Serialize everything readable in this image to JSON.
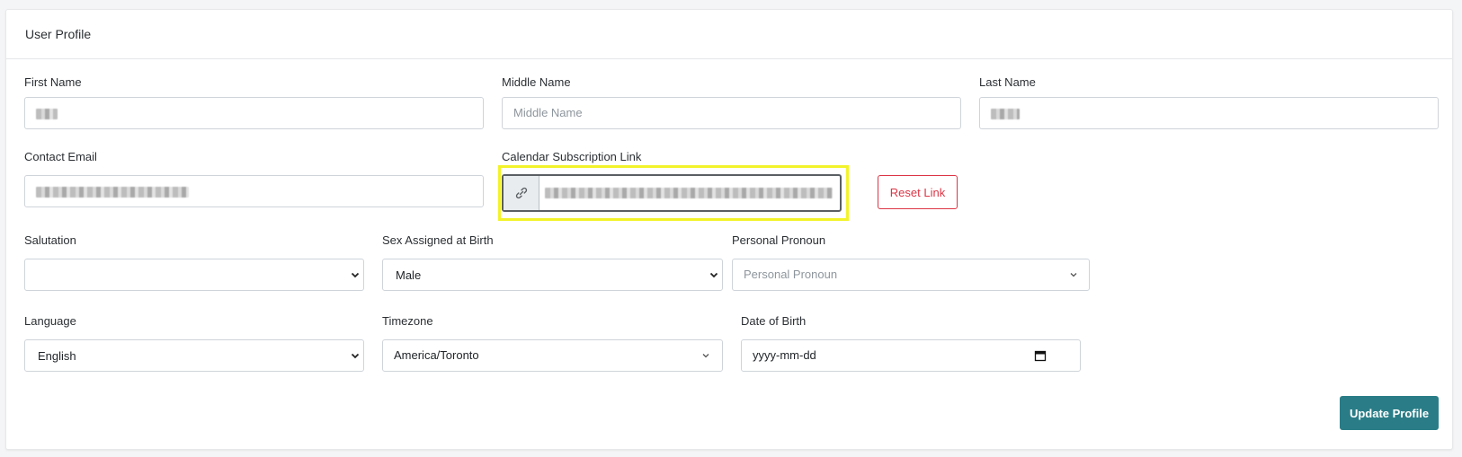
{
  "header": {
    "title": "User Profile"
  },
  "fields": {
    "first_name": {
      "label": "First Name"
    },
    "middle_name": {
      "label": "Middle Name",
      "placeholder": "Middle Name"
    },
    "last_name": {
      "label": "Last Name"
    },
    "contact_email": {
      "label": "Contact Email"
    },
    "calendar_link": {
      "label": "Calendar Subscription Link",
      "icon": "link-icon"
    },
    "salutation": {
      "label": "Salutation",
      "value": ""
    },
    "sex": {
      "label": "Sex Assigned at Birth",
      "value": "Male"
    },
    "pronoun": {
      "label": "Personal Pronoun",
      "placeholder": "Personal Pronoun"
    },
    "language": {
      "label": "Language",
      "value": "English"
    },
    "timezone": {
      "label": "Timezone",
      "value": "America/Toronto"
    },
    "dob": {
      "label": "Date of Birth",
      "value": "yyyy-mm-dd",
      "icon": "calendar-icon"
    }
  },
  "actions": {
    "reset_link": "Reset Link",
    "update_profile": "Update Profile"
  },
  "colors": {
    "primary": "#2a7d87",
    "danger": "#dc3545",
    "highlight": "#f3f32a"
  }
}
